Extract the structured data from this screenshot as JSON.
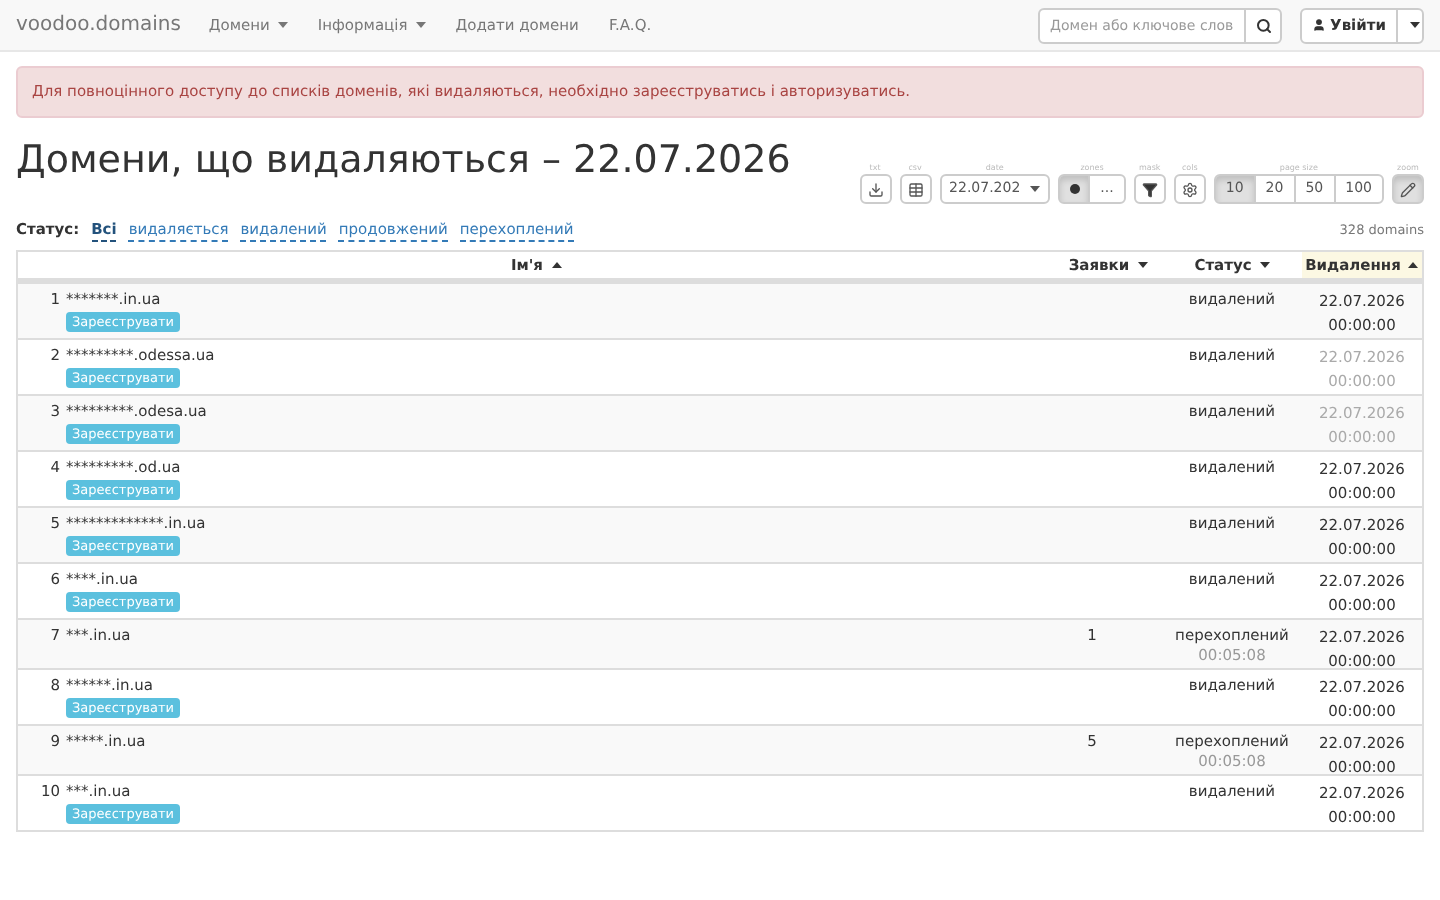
{
  "navbar": {
    "brand": "voodoo.domains",
    "menus": [
      {
        "label": "Домени",
        "dropdown": true
      },
      {
        "label": "Інформація",
        "dropdown": true
      },
      {
        "label": "Додати домени",
        "dropdown": false
      },
      {
        "label": "F.A.Q.",
        "dropdown": false
      }
    ],
    "search": {
      "placeholder": "Домен або ключове слов"
    },
    "login": "Увійти"
  },
  "alert": "Для повноцінного доступу до списків доменів, які видаляються, необхідно зареєструватись і авторизуватись.",
  "title": "Домени, що видаляються – 22.07.2026",
  "toolbar": [
    {
      "label": "txt",
      "buttons": [
        {
          "kind": "icon",
          "selected": false
        }
      ]
    },
    {
      "label": "csv",
      "buttons": [
        {
          "kind": "icon",
          "selected": false
        }
      ]
    },
    {
      "label": "date",
      "buttons": [
        {
          "kind": "select",
          "text": "22.07.202",
          "selected": false
        }
      ]
    },
    {
      "label": "zones",
      "buttons": [
        {
          "kind": "icon",
          "selected": true
        },
        {
          "kind": "text",
          "text": "...",
          "selected": false
        }
      ]
    },
    {
      "label": "mask",
      "buttons": [
        {
          "kind": "icon",
          "selected": false
        }
      ]
    },
    {
      "label": "cols",
      "buttons": [
        {
          "kind": "icon",
          "selected": false
        }
      ]
    },
    {
      "label": "page size",
      "buttons": [
        {
          "kind": "text",
          "text": "10",
          "selected": true
        },
        {
          "kind": "text",
          "text": "20",
          "selected": false
        },
        {
          "kind": "text",
          "text": "50",
          "selected": false
        },
        {
          "kind": "text",
          "text": "100",
          "selected": false
        }
      ]
    },
    {
      "label": "zoom",
      "buttons": [
        {
          "kind": "icon",
          "selected": true
        }
      ]
    }
  ],
  "filter": {
    "label": "Статус:",
    "options": [
      {
        "label": "Всі",
        "selected": true
      },
      {
        "label": "видаляється",
        "selected": false
      },
      {
        "label": "видалений",
        "selected": false
      },
      {
        "label": "продовжений",
        "selected": false
      },
      {
        "label": "перехоплений",
        "selected": false
      }
    ]
  },
  "count": "328 domains",
  "table": {
    "columns": [
      {
        "label": "Ім'я",
        "sort_ascending": true,
        "highlighted": false
      },
      {
        "label": "Заявки",
        "sort_ascending": false,
        "highlighted": false
      },
      {
        "label": "Статус",
        "sort_ascending": false,
        "highlighted": false
      },
      {
        "label": "Видалення",
        "sort_ascending": true,
        "highlighted": true
      }
    ],
    "rows": [
      {
        "num": "1",
        "domain": "*******.in.ua",
        "button": "Зареєструвати",
        "status": "видалений",
        "date": "22.07.2026",
        "time": "00:00:00",
        "dimmed": false
      },
      {
        "num": "2",
        "domain": "*********.odessa.ua",
        "button": "Зареєструвати",
        "status": "видалений",
        "date": "22.07.2026",
        "time": "00:00:00",
        "dimmed": true
      },
      {
        "num": "3",
        "domain": "*********.odesa.ua",
        "button": "Зареєструвати",
        "status": "видалений",
        "date": "22.07.2026",
        "time": "00:00:00",
        "dimmed": true
      },
      {
        "num": "4",
        "domain": "*********.od.ua",
        "button": "Зареєструвати",
        "status": "видалений",
        "date": "22.07.2026",
        "time": "00:00:00",
        "dimmed": false
      },
      {
        "num": "5",
        "domain": "*************.in.ua",
        "button": "Зареєструвати",
        "status": "видалений",
        "date": "22.07.2026",
        "time": "00:00:00",
        "dimmed": false
      },
      {
        "num": "6",
        "domain": "****.in.ua",
        "button": "Зареєструвати",
        "status": "видалений",
        "date": "22.07.2026",
        "time": "00:00:00",
        "dimmed": false
      },
      {
        "num": "7",
        "domain": "***.in.ua",
        "requests": "1",
        "status": "перехоплений",
        "status_time": "00:05:08",
        "date": "22.07.2026",
        "time": "00:00:00",
        "dimmed": false
      },
      {
        "num": "8",
        "domain": "******.in.ua",
        "button": "Зареєструвати",
        "status": "видалений",
        "date": "22.07.2026",
        "time": "00:00:00",
        "dimmed": false
      },
      {
        "num": "9",
        "domain": "*****.in.ua",
        "requests": "5",
        "status": "перехоплений",
        "status_time": "00:05:08",
        "date": "22.07.2026",
        "time": "00:00:00",
        "dimmed": false
      },
      {
        "num": "10",
        "domain": "***.in.ua",
        "button": "Зареєструвати",
        "status": "видалений",
        "date": "22.07.2026",
        "time": "00:00:00",
        "dimmed": false
      }
    ]
  }
}
